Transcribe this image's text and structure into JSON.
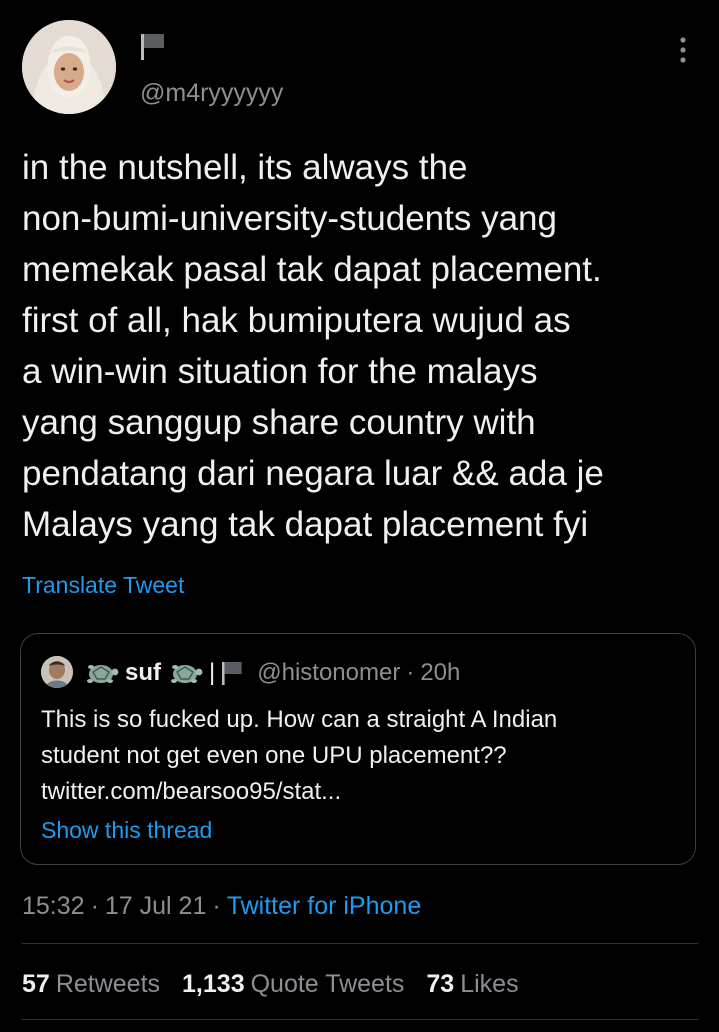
{
  "author": {
    "handle": "@m4ryyyyyy",
    "name_icon": "flag-icon",
    "avatar_icon": "avatar"
  },
  "tweet": {
    "lines": [
      "in the nutshell, its always the",
      "non-bumi-university-students yang",
      "memekak pasal tak dapat placement.",
      "first of all, hak bumiputera wujud as",
      "a win-win situation for the malays",
      "yang sanggup share country with",
      "pendatang dari negara luar && ada je",
      "Malays yang tak dapat placement fyi"
    ],
    "translate_label": "Translate Tweet"
  },
  "quote": {
    "name": "suf",
    "separator": "|",
    "handle": "@histonomer",
    "dot": "·",
    "time": "20h",
    "lines": [
      "This is so fucked up. How can a straight A Indian",
      "student not get even one UPU placement??",
      "twitter.com/bearsoo95/stat..."
    ],
    "show_thread_label": "Show this thread"
  },
  "meta": {
    "time": "15:32",
    "dot": "·",
    "date": "17 Jul 21",
    "source": "Twitter for iPhone"
  },
  "stats": {
    "retweets_count": "57",
    "retweets_label": "Retweets",
    "quotes_count": "1,133",
    "quotes_label": "Quote Tweets",
    "likes_count": "73",
    "likes_label": "Likes"
  },
  "colors": {
    "background": "#000000",
    "text": "#eef0f1",
    "secondary": "#8b8f94",
    "accent": "#1d9bf0",
    "border": "#3a3d41"
  }
}
